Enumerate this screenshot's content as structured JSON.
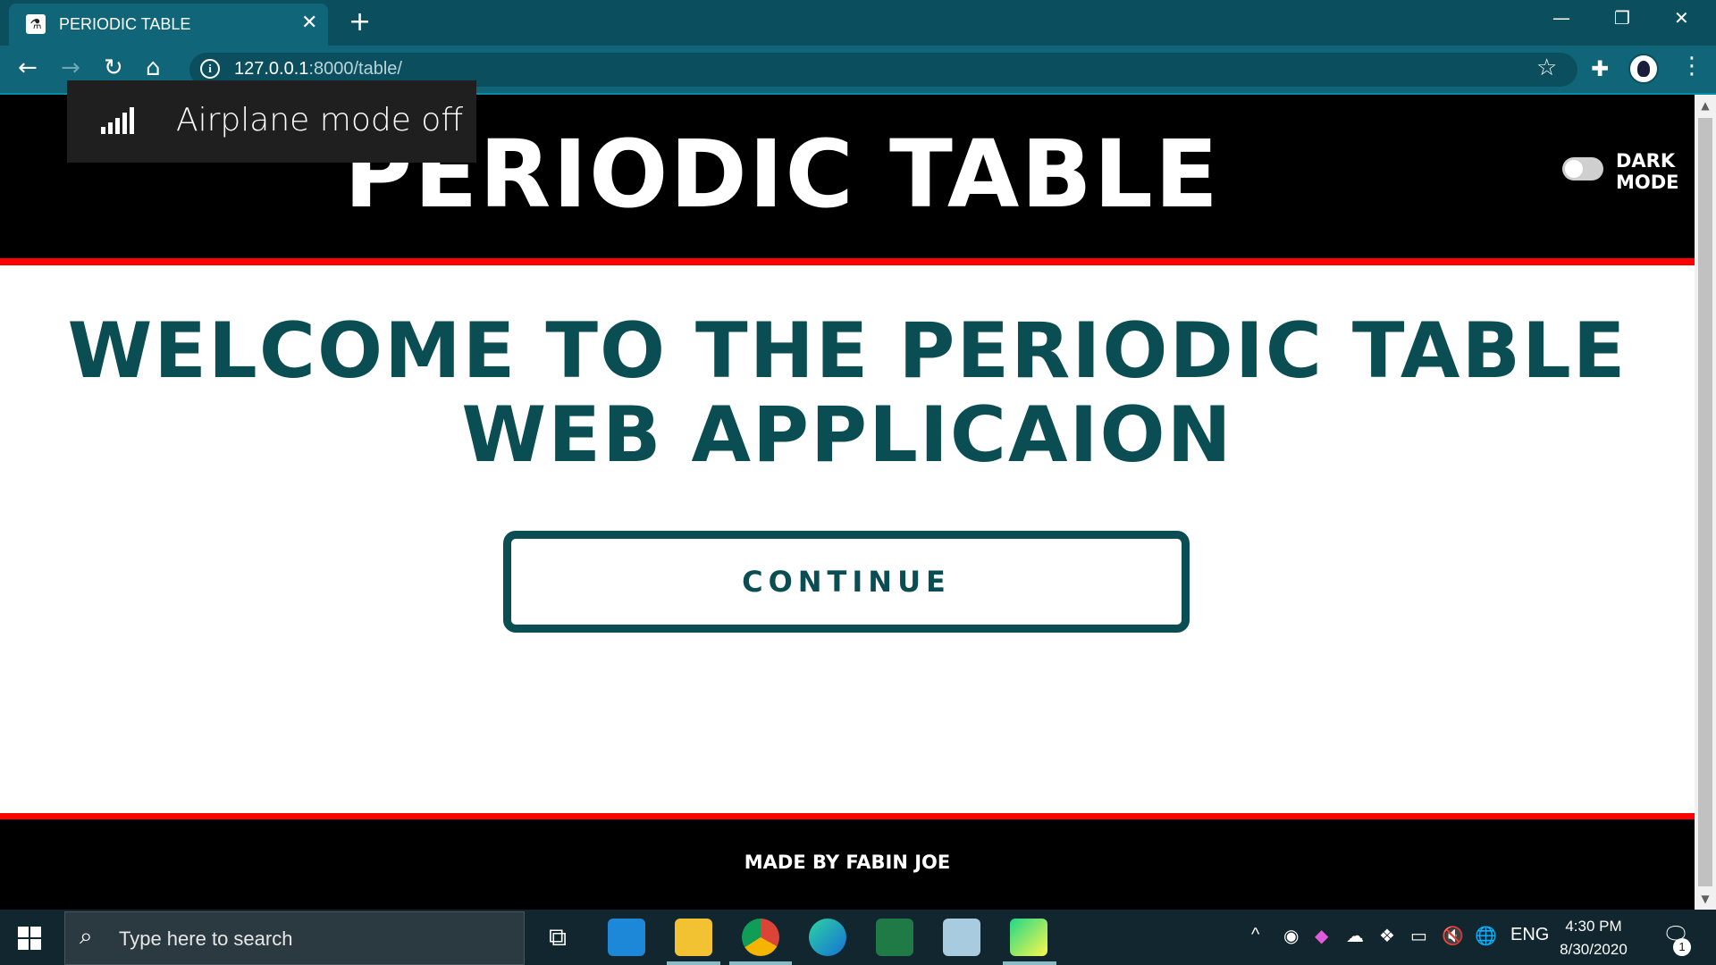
{
  "browser": {
    "tab_title": "PERIODIC TABLE",
    "tab_close": "✕",
    "new_tab": "+",
    "url_host": "127.0.0.1",
    "url_path": ":8000/table/",
    "window_buttons": {
      "minimize": "—",
      "restore": "❐",
      "close": "✕"
    },
    "icons": [
      "back-icon",
      "forward-icon",
      "reload-icon",
      "home-icon",
      "site-info-icon",
      "bookmark-star-icon",
      "extensions-icon",
      "profile-avatar",
      "menu-icon"
    ]
  },
  "page": {
    "header_title": "PERIODIC TABLE",
    "dark_mode_label_line1": "DARK",
    "dark_mode_label_line2": "MODE",
    "dark_mode_on": false,
    "welcome_line1": "WELCOME TO THE PERIODIC TABLE",
    "welcome_line2": "WEB APPLICAION",
    "continue_label": "CONTINUE",
    "footer_text": "MADE BY FABIN JOE",
    "colors": {
      "accent": "#0a4d52",
      "divider": "#ff0000",
      "header_bg": "#000000"
    }
  },
  "toast": {
    "text": "Airplane mode off",
    "icon": "signal-bars-icon"
  },
  "taskbar": {
    "search_placeholder": "Type here to search",
    "pinned_apps": [
      "task-view",
      "mail",
      "file-explorer",
      "chrome",
      "edge",
      "excel",
      "notepad",
      "pycharm"
    ],
    "tray_language": "ENG",
    "time": "4:30 PM",
    "date": "8/30/2020",
    "notification_count": "1"
  }
}
